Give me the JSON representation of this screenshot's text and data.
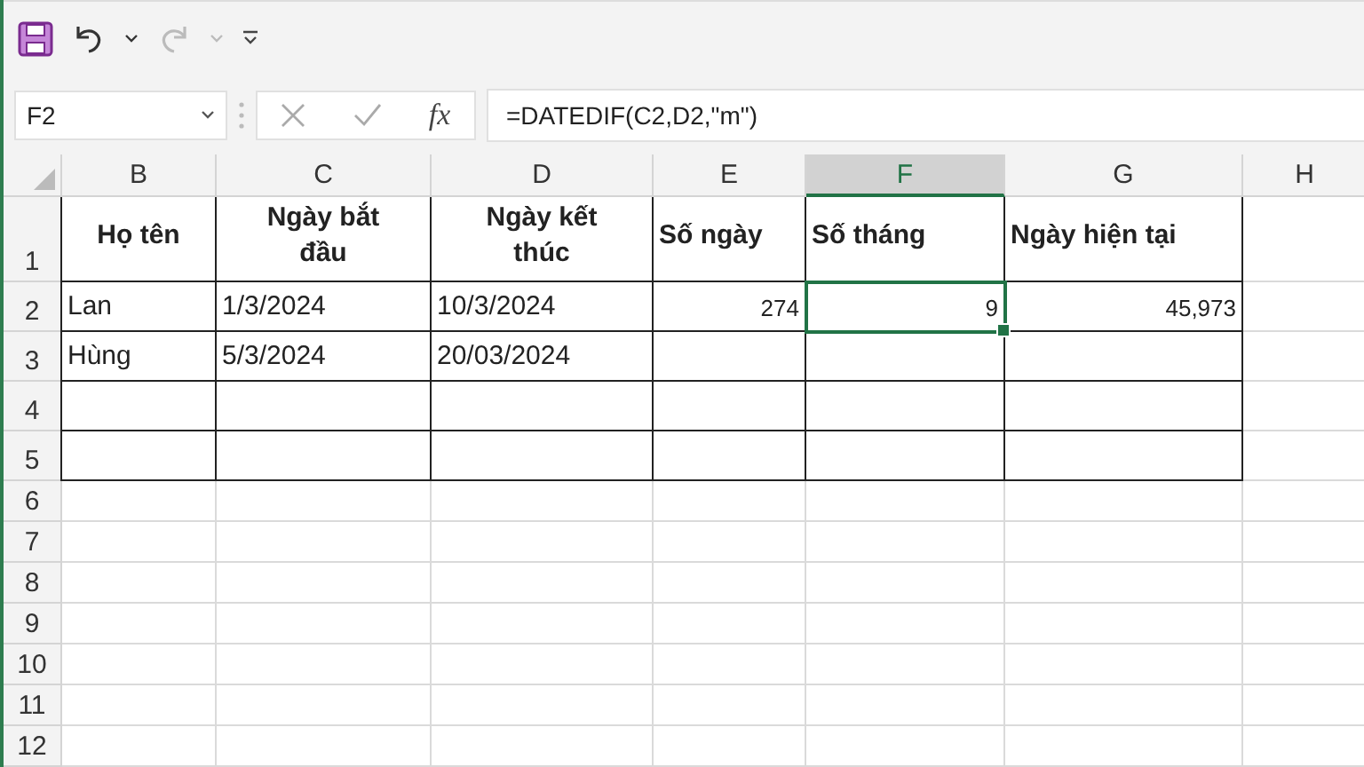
{
  "quick_access": {
    "undo_enabled": true,
    "redo_enabled": false
  },
  "formula_bar": {
    "name_box": "F2",
    "fx": "fx",
    "formula": "=DATEDIF(C2,D2,\"m\")"
  },
  "columns": [
    {
      "label": "B",
      "selected": false
    },
    {
      "label": "C",
      "selected": false
    },
    {
      "label": "D",
      "selected": false
    },
    {
      "label": "E",
      "selected": false
    },
    {
      "label": "F",
      "selected": true
    },
    {
      "label": "G",
      "selected": false
    },
    {
      "label": "H",
      "selected": false
    }
  ],
  "rows": [
    {
      "label": "1",
      "kind": "header",
      "cells": [
        {
          "text": "Họ tên",
          "kind": "text",
          "selected": false
        },
        {
          "text": "Ngày bắt đầu",
          "kind": "text",
          "selected": false
        },
        {
          "text": "Ngày kết thúc",
          "kind": "text",
          "selected": false
        },
        {
          "text": "Số ngày",
          "kind": "text",
          "selected": false
        },
        {
          "text": "Số tháng",
          "kind": "text",
          "selected": false
        },
        {
          "text": "Ngày hiện tại",
          "kind": "text",
          "selected": false
        }
      ]
    },
    {
      "label": "2",
      "kind": "data",
      "cells": [
        {
          "text": "Lan",
          "kind": "text",
          "selected": false
        },
        {
          "text": "1/3/2024",
          "kind": "text",
          "selected": false
        },
        {
          "text": "10/3/2024",
          "kind": "text",
          "selected": false
        },
        {
          "text": "274",
          "kind": "number",
          "selected": false
        },
        {
          "text": "9",
          "kind": "number",
          "selected": true
        },
        {
          "text": "45,973",
          "kind": "number",
          "selected": false
        }
      ]
    },
    {
      "label": "3",
      "kind": "data",
      "cells": [
        {
          "text": "Hùng",
          "kind": "text",
          "selected": false
        },
        {
          "text": "5/3/2024",
          "kind": "text",
          "selected": false
        },
        {
          "text": "20/03/2024",
          "kind": "text",
          "selected": false
        },
        {
          "kind": "empty",
          "selected": false
        },
        {
          "kind": "empty",
          "selected": false
        },
        {
          "kind": "empty",
          "selected": false
        }
      ]
    },
    {
      "label": "4",
      "kind": "data",
      "cells": [
        {
          "kind": "empty",
          "selected": false
        },
        {
          "kind": "empty",
          "selected": false
        },
        {
          "kind": "empty",
          "selected": false
        },
        {
          "kind": "empty",
          "selected": false
        },
        {
          "kind": "empty",
          "selected": false
        },
        {
          "kind": "empty",
          "selected": false
        }
      ]
    },
    {
      "label": "5",
      "kind": "data",
      "cells": [
        {
          "kind": "empty",
          "selected": false
        },
        {
          "kind": "empty",
          "selected": false
        },
        {
          "kind": "empty",
          "selected": false
        },
        {
          "kind": "empty",
          "selected": false
        },
        {
          "kind": "empty",
          "selected": false
        },
        {
          "kind": "empty",
          "selected": false
        }
      ]
    },
    {
      "label": "6",
      "kind": "blank"
    },
    {
      "label": "7",
      "kind": "blank"
    },
    {
      "label": "8",
      "kind": "blank"
    },
    {
      "label": "9",
      "kind": "blank"
    },
    {
      "label": "10",
      "kind": "blank"
    },
    {
      "label": "11",
      "kind": "blank"
    },
    {
      "label": "12",
      "kind": "blank"
    }
  ]
}
